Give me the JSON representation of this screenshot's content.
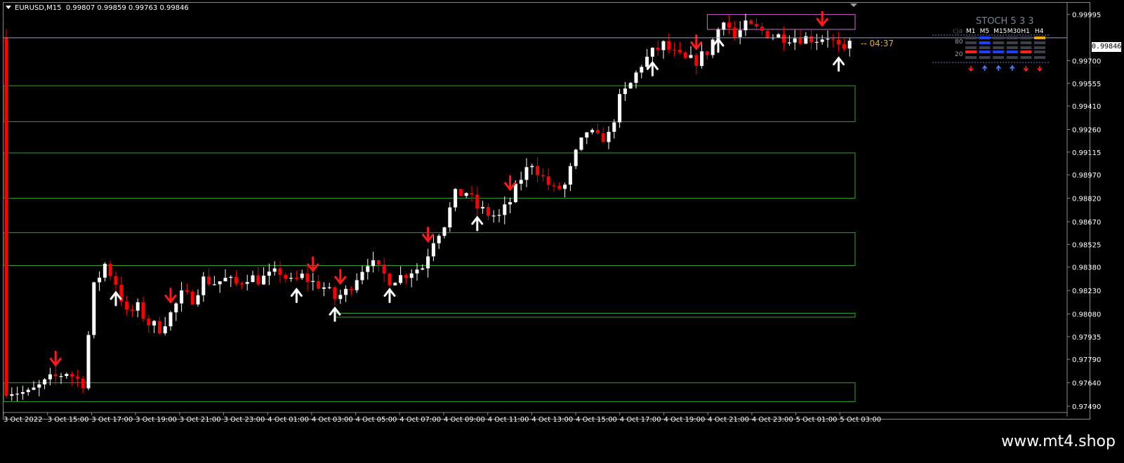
{
  "header": {
    "symbol": "EURUSD,M15",
    "ohlc": "0.99807 0.99859 0.99763 0.99846"
  },
  "current_price": "0.99846",
  "countdown": "04:37",
  "watermark": "www.mt4.shop",
  "colors": {
    "bull": "#ffffff",
    "bear": "#ff0000",
    "zone": "#2fa12f",
    "supply_zone": "#d966d9",
    "grid_text": "#ffffff",
    "price_line": "#8fa1c9",
    "countdown": "#e8b000"
  },
  "stoch_panel": {
    "title": "STOCH  5 3 3",
    "corner_label": "cja",
    "timeframes": [
      "M1",
      "M5",
      "M15",
      "M30",
      "H1",
      "H4"
    ],
    "level_high": "80",
    "level_low": "20",
    "row_high_colors": [
      "#404040",
      "#1f3fff",
      "#404040",
      "#404040",
      "#404040",
      "#f5a500"
    ],
    "row_low_colors": [
      "#ff2020",
      "#1f3fff",
      "#1f3fff",
      "#1f3fff",
      "#ff2020",
      "#404040"
    ],
    "arrows": [
      "down",
      "up",
      "up",
      "up",
      "down",
      "down"
    ]
  },
  "chart_data": {
    "type": "candlestick",
    "symbol": "EURUSD",
    "timeframe": "M15",
    "y_ticks": [
      "0.99995",
      "0.99700",
      "0.99555",
      "0.99410",
      "0.99260",
      "0.99115",
      "0.98970",
      "0.98820",
      "0.98670",
      "0.98525",
      "0.98380",
      "0.98230",
      "0.98080",
      "0.97935",
      "0.97790",
      "0.97640",
      "0.97490"
    ],
    "ylim": [
      0.9745,
      1.0007
    ],
    "x_ticks": [
      "3 Oct 2022",
      "3 Oct 15:00",
      "3 Oct 17:00",
      "3 Oct 19:00",
      "3 Oct 21:00",
      "3 Oct 23:00",
      "4 Oct 01:00",
      "4 Oct 03:00",
      "4 Oct 05:00",
      "4 Oct 07:00",
      "4 Oct 09:00",
      "4 Oct 11:00",
      "4 Oct 13:00",
      "4 Oct 15:00",
      "4 Oct 17:00",
      "4 Oct 19:00",
      "4 Oct 21:00",
      "4 Oct 23:00",
      "5 Oct 01:00",
      "5 Oct 03:00"
    ],
    "anchors": [
      [
        -0.5,
        0.976
      ],
      [
        4,
        0.9757
      ],
      [
        8,
        0.9766
      ],
      [
        11,
        0.9771
      ],
      [
        14,
        0.9764
      ],
      [
        16,
        0.9825
      ],
      [
        18,
        0.984
      ],
      [
        20,
        0.9828
      ],
      [
        22,
        0.9808
      ],
      [
        24,
        0.9812
      ],
      [
        26,
        0.9802
      ],
      [
        28,
        0.9799
      ],
      [
        30,
        0.9808
      ],
      [
        32,
        0.982
      ],
      [
        34,
        0.9818
      ],
      [
        36,
        0.983
      ],
      [
        38,
        0.9828
      ],
      [
        40,
        0.983
      ],
      [
        42,
        0.9827
      ],
      [
        44,
        0.9832
      ],
      [
        46,
        0.983
      ],
      [
        48,
        0.9832
      ],
      [
        50,
        0.9835
      ],
      [
        52,
        0.9828
      ],
      [
        54,
        0.9832
      ],
      [
        56,
        0.9828
      ],
      [
        58,
        0.9825
      ],
      [
        60,
        0.9818
      ],
      [
        62,
        0.9822
      ],
      [
        64,
        0.9832
      ],
      [
        66,
        0.9842
      ],
      [
        68,
        0.9836
      ],
      [
        70,
        0.983
      ],
      [
        72,
        0.9832
      ],
      [
        74,
        0.9836
      ],
      [
        76,
        0.9838
      ],
      [
        78,
        0.9856
      ],
      [
        80,
        0.9866
      ],
      [
        82,
        0.9884
      ],
      [
        84,
        0.9886
      ],
      [
        86,
        0.9876
      ],
      [
        88,
        0.9872
      ],
      [
        90,
        0.987
      ],
      [
        92,
        0.988
      ],
      [
        94,
        0.9895
      ],
      [
        96,
        0.9905
      ],
      [
        98,
        0.9895
      ],
      [
        100,
        0.9887
      ],
      [
        102,
        0.989
      ],
      [
        104,
        0.991
      ],
      [
        106,
        0.9925
      ],
      [
        108,
        0.992
      ],
      [
        110,
        0.9922
      ],
      [
        112,
        0.9945
      ],
      [
        114,
        0.9955
      ],
      [
        116,
        0.9968
      ],
      [
        118,
        0.9975
      ],
      [
        120,
        0.998
      ],
      [
        122,
        0.9974
      ],
      [
        124,
        0.997
      ],
      [
        126,
        0.997
      ],
      [
        128,
        0.9976
      ],
      [
        130,
        0.999
      ],
      [
        131,
        0.9998
      ],
      [
        133,
        0.9985
      ],
      [
        135,
        0.9992
      ],
      [
        137,
        0.999
      ],
      [
        140,
        0.9986
      ],
      [
        144,
        0.9985
      ],
      [
        148,
        0.9984
      ],
      [
        150,
        0.9986
      ],
      [
        151,
        0.9982
      ],
      [
        153,
        0.9974
      ],
      [
        154.5,
        0.99846
      ]
    ],
    "bear_arrows": [
      9,
      30,
      56,
      61,
      77,
      92,
      126,
      149
    ],
    "bull_arrows": [
      20,
      53,
      60,
      70,
      86,
      118,
      130,
      152
    ],
    "zones": [
      {
        "kind": "demand",
        "top": 0.9954,
        "bottom": 0.9931,
        "x_end": 155
      },
      {
        "kind": "demand",
        "top": 0.9911,
        "bottom": 0.9882,
        "x_end": 155
      },
      {
        "kind": "demand",
        "top": 0.986,
        "bottom": 0.9839,
        "x_end": 155
      },
      {
        "kind": "demand",
        "top": 0.98085,
        "bottom": 0.9806,
        "x_start": 60,
        "x_end": 155
      },
      {
        "kind": "demand",
        "top": 0.9764,
        "bottom": 0.9752,
        "x_end": 155
      },
      {
        "kind": "supply",
        "top": 0.99995,
        "bottom": 0.999,
        "x_start": 128,
        "x_end": 155
      }
    ]
  }
}
